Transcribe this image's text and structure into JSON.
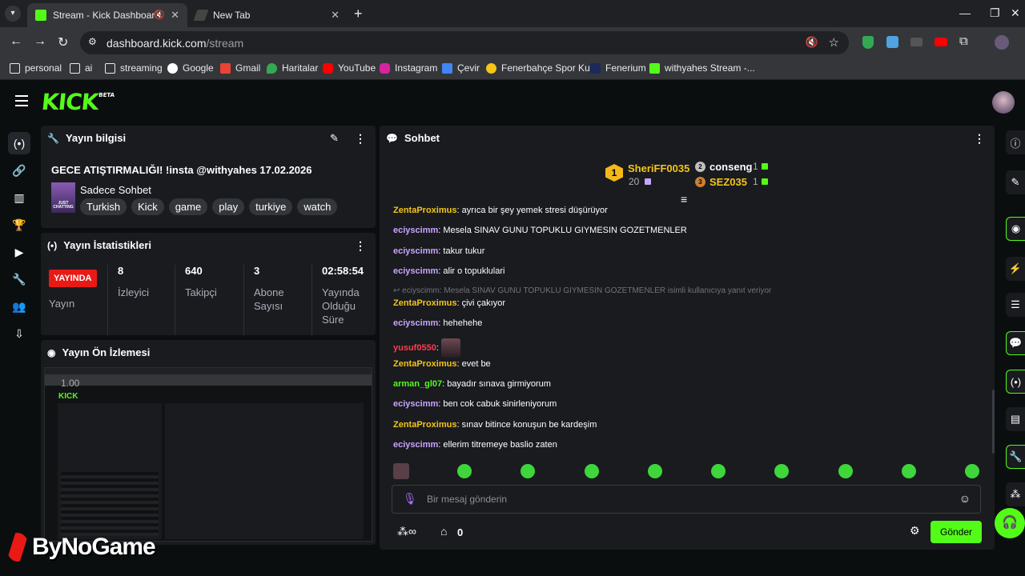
{
  "browser": {
    "tabs": [
      {
        "title": "Stream - Kick Dashboard",
        "active": true
      },
      {
        "title": "New Tab",
        "active": false
      }
    ],
    "new_tab": "+",
    "url_host": "dashboard.kick.com",
    "url_path": "/stream",
    "bookmarks": [
      "personal",
      "ai",
      "streaming",
      "Google",
      "Gmail",
      "Haritalar",
      "YouTube",
      "Instagram",
      "Çevir",
      "Fenerbahçe Spor Ku...",
      "Fenerium",
      "withyahes Stream -..."
    ]
  },
  "app": {
    "logo": "KICK",
    "logo_badge": "BETA",
    "accent": "#53fc18"
  },
  "stream_info": {
    "title": "Yayın bilgisi",
    "stream_title": "GECE ATIŞTIRMALIĞI! !insta @withyahes 17.02.2026",
    "category": "Sadece Sohbet",
    "category_thumb_text": "JUST CHATTING",
    "tags": [
      "Turkish",
      "Kick",
      "game",
      "play",
      "turkiye",
      "watch"
    ]
  },
  "stats": {
    "title": "Yayın İstatistikleri",
    "live_badge": "YAYINDA",
    "live_label": "Yayın",
    "items": [
      {
        "value": "8",
        "label": "İzleyici"
      },
      {
        "value": "640",
        "label": "Takipçi"
      },
      {
        "value": "3",
        "label": "Abone Sayısı"
      },
      {
        "value": "02:58:54",
        "label": "Yayında Olduğu Süre"
      }
    ]
  },
  "preview": {
    "title": "Yayın Ön İzlemesi",
    "zoom_overlay": "1.00"
  },
  "chat": {
    "title": "Sohbet",
    "leaderboard": {
      "first": {
        "rank": "1",
        "name": "SheriFF0035",
        "count": "20"
      },
      "second": {
        "rank": "2",
        "name": "conseng",
        "count": "1"
      },
      "third": {
        "rank": "3",
        "name": "SEZ035",
        "count": "1"
      }
    },
    "messages": [
      {
        "user": "ZentaProximus",
        "color": "#f5c518",
        "text": "ayrıca bir şey yemek stresi düşürüyor"
      },
      {
        "user": "eciyscimm",
        "color": "#c9a4ff",
        "text": "Mesela SINAV GUNU TOPUKLU GIYMESIN GOZETMENLER"
      },
      {
        "user": "eciyscimm",
        "color": "#c9a4ff",
        "text": "takur tukur"
      },
      {
        "user": "eciyscimm",
        "color": "#c9a4ff",
        "text": "alir o topuklulari"
      },
      {
        "user": "ZentaProximus",
        "color": "#f5c518",
        "text": "çivi çakıyor"
      },
      {
        "user": "eciyscimm",
        "color": "#c9a4ff",
        "text": "hehehehe"
      },
      {
        "user": "yusuf0550",
        "color": "#ff3b4b",
        "text": ""
      },
      {
        "user": "ZentaProximus",
        "color": "#f5c518",
        "text": "evet be"
      },
      {
        "user": "arman_gl07",
        "color": "#53fc18",
        "text": "bayadır sınava girmiyorum"
      },
      {
        "user": "eciyscimm",
        "color": "#c9a4ff",
        "text": "ben cok cabuk sinirleniyorum"
      },
      {
        "user": "ZentaProximus",
        "color": "#f5c518",
        "text": "sınav bitince konuşun be kardeşim"
      },
      {
        "user": "eciyscimm",
        "color": "#c9a4ff",
        "text": "ellerim titremeye baslio zaten"
      }
    ],
    "reply_note": "eciyscimm: Mesela SINAV GUNU TOPUKLU GIYMESIN GOZETMENLER isimli kullanıcıya yanıt veriyor",
    "input_placeholder": "Bir mesaj gönderin",
    "points": "0",
    "send_label": "Gönder"
  },
  "watermark": "ByNoGame"
}
